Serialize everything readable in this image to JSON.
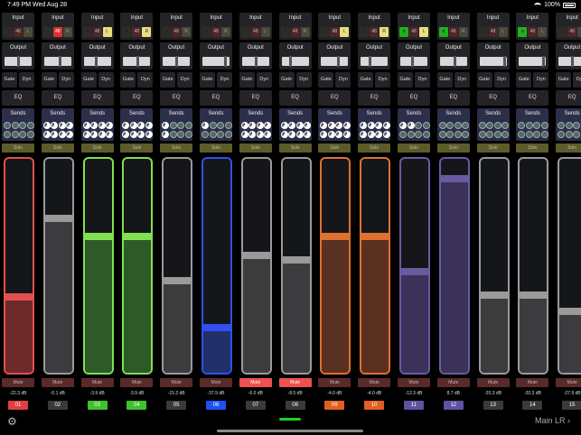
{
  "status": {
    "time": "7:49 PM",
    "date": "Wed Aug 28",
    "battery": "100%"
  },
  "labels": {
    "input": "Input",
    "output": "Output",
    "gate": "Gate",
    "dyn": "Dyn",
    "eq": "EQ",
    "sends": "Sends",
    "solo": "Solo",
    "mute": "Mute",
    "phase": "ø",
    "p48": "48"
  },
  "footer": {
    "main_lr": "Main LR",
    "gear_icon": "gear-icon",
    "chevron_icon": "chevron-right-icon"
  },
  "channels": [
    {
      "num": "01",
      "db": "-22.3 dB",
      "color": "#e05050",
      "fill": "#6e2a2a",
      "level": 0.35,
      "phase": false,
      "p48": false,
      "lr": false,
      "lr_label": "L",
      "mute": false,
      "out": 0.5,
      "sends": [
        0,
        0,
        0,
        0,
        0,
        0,
        0,
        0
      ]
    },
    {
      "num": "02",
      "db": "-0.1 dB",
      "color": "#9a9a9a",
      "fill": "#3c3c3e",
      "level": 0.73,
      "phase": false,
      "p48": true,
      "lr": false,
      "lr_label": "R",
      "mute": false,
      "out": 0.6,
      "sends": [
        1,
        1,
        1,
        1,
        1,
        1,
        1,
        1
      ]
    },
    {
      "num": "03",
      "db": "-3.9 dB",
      "color": "#80e050",
      "fill": "#2e5a2a",
      "level": 0.64,
      "phase": false,
      "p48": false,
      "lr": true,
      "lr_label": "L",
      "mute": false,
      "out": 0.45,
      "sends": [
        1,
        1,
        1,
        1,
        1,
        1,
        1,
        1
      ]
    },
    {
      "num": "04",
      "db": "-3.9 dB",
      "color": "#80e050",
      "fill": "#2e5a2a",
      "level": 0.64,
      "phase": false,
      "p48": false,
      "lr": true,
      "lr_label": "R",
      "mute": false,
      "out": 0.55,
      "sends": [
        1,
        1,
        1,
        1,
        1,
        1,
        1,
        1
      ]
    },
    {
      "num": "05",
      "db": "-15.2 dB",
      "color": "#9a9a9a",
      "fill": "#3c3c3e",
      "level": 0.43,
      "phase": false,
      "p48": false,
      "lr": false,
      "lr_label": "R",
      "mute": false,
      "out": 0.5,
      "sends": [
        1,
        0,
        0,
        0,
        1,
        0,
        0,
        0
      ]
    },
    {
      "num": "06",
      "db": "-37.9 dB",
      "color": "#3050f0",
      "fill": "#22306a",
      "level": 0.2,
      "phase": false,
      "p48": false,
      "lr": false,
      "lr_label": "R",
      "mute": false,
      "out": 0.9,
      "sends": [
        1,
        0,
        0,
        0,
        0,
        0,
        0,
        0
      ]
    },
    {
      "num": "07",
      "db": "-6.0 dB",
      "color": "#9a9a9a",
      "fill": "#3c3c3e",
      "level": 0.55,
      "phase": false,
      "p48": false,
      "lr": false,
      "lr_label": "L",
      "mute": true,
      "out": 0.5,
      "sends": [
        1,
        1,
        1,
        1,
        1,
        1,
        1,
        1
      ]
    },
    {
      "num": "08",
      "db": "-8.5 dB",
      "color": "#9a9a9a",
      "fill": "#3c3c3e",
      "level": 0.53,
      "phase": false,
      "p48": false,
      "lr": false,
      "lr_label": "R",
      "mute": true,
      "out": 0.3,
      "sends": [
        1,
        1,
        1,
        1,
        1,
        1,
        1,
        1
      ]
    },
    {
      "num": "09",
      "db": "-4.0 dB",
      "color": "#e07030",
      "fill": "#5a3020",
      "level": 0.64,
      "phase": false,
      "p48": false,
      "lr": true,
      "lr_label": "L",
      "mute": false,
      "out": 0.65,
      "sends": [
        1,
        1,
        1,
        1,
        1,
        1,
        1,
        1
      ]
    },
    {
      "num": "10",
      "db": "-4.0 dB",
      "color": "#e07030",
      "fill": "#5a3020",
      "level": 0.64,
      "phase": false,
      "p48": false,
      "lr": true,
      "lr_label": "R",
      "mute": false,
      "out": 0.35,
      "sends": [
        1,
        1,
        1,
        1,
        1,
        1,
        1,
        1
      ]
    },
    {
      "num": "11",
      "db": "-12.3 dB",
      "color": "#6a5aa0",
      "fill": "#3a3258",
      "level": 0.47,
      "phase": true,
      "p48": false,
      "lr": true,
      "lr_label": "L",
      "mute": false,
      "out": 0.45,
      "sends": [
        1,
        1,
        0,
        0,
        0,
        0,
        0,
        0
      ]
    },
    {
      "num": "12",
      "db": "8.7 dB",
      "color": "#6a5aa0",
      "fill": "#3a3258",
      "level": 0.92,
      "phase": true,
      "p48": false,
      "lr": false,
      "lr_label": "R",
      "mute": false,
      "out": 0.55,
      "sends": [
        0,
        0,
        0,
        0,
        0,
        0,
        0,
        0
      ]
    },
    {
      "num": "13",
      "db": "-20.3 dB",
      "color": "#9a9a9a",
      "fill": "#3c3c3e",
      "level": 0.36,
      "phase": false,
      "p48": false,
      "lr": false,
      "lr_label": "L",
      "mute": false,
      "out": 0.95,
      "sends": [
        0,
        0,
        0,
        0,
        0,
        0,
        0,
        0
      ]
    },
    {
      "num": "14",
      "db": "-20.3 dB",
      "color": "#9a9a9a",
      "fill": "#3c3c3e",
      "level": 0.36,
      "phase": true,
      "p48": false,
      "lr": false,
      "lr_label": "L",
      "mute": false,
      "out": 0.95,
      "sends": [
        0,
        0,
        0,
        0,
        0,
        0,
        0,
        0
      ]
    },
    {
      "num": "15",
      "db": "-27.9 dB",
      "color": "#9a9a9a",
      "fill": "#3c3c3e",
      "level": 0.28,
      "phase": false,
      "p48": false,
      "lr": false,
      "lr_label": "L",
      "mute": false,
      "out": 0.5,
      "sends": [
        0,
        0,
        0,
        0,
        0,
        0,
        0,
        0
      ]
    }
  ]
}
